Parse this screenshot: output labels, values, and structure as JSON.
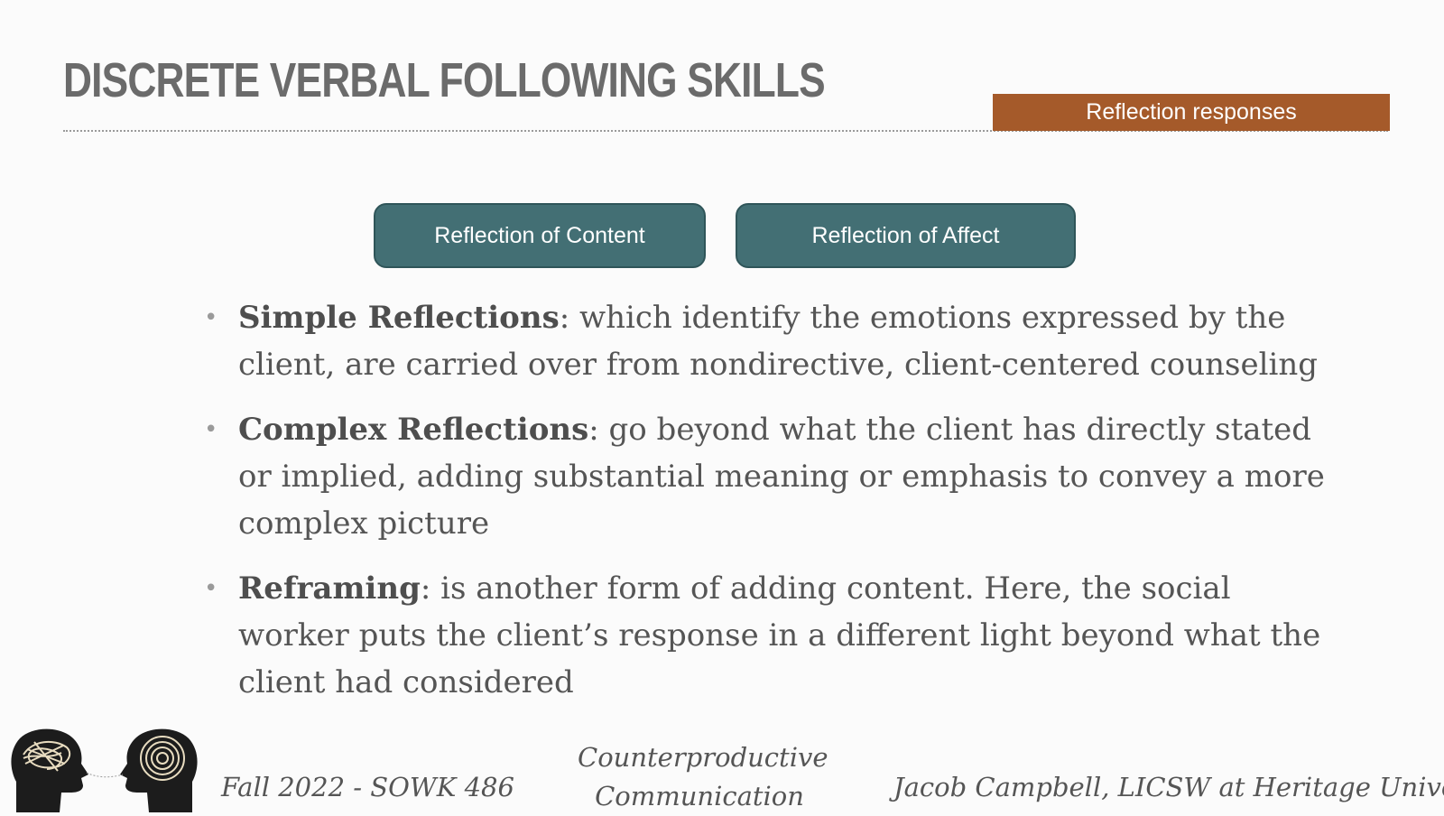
{
  "header": {
    "title": "DISCRETE VERBAL FOLLOWING SKILLS",
    "section_tag": "Reflection responses"
  },
  "categories": [
    {
      "label": "Reflection of Content"
    },
    {
      "label": "Reflection of Affect"
    }
  ],
  "bullets": [
    {
      "term": "Simple Reflections",
      "text": ": which identify the emotions expressed by the client, are carried over from nondirective, client-centered counseling"
    },
    {
      "term": "Complex Reflections",
      "text": ": go beyond what the client has directly stated or implied, adding substantial meaning or emphasis to convey a more complex picture"
    },
    {
      "term": "Reframing",
      "text": ": is another form of adding content. Here, the social worker puts the client’s response in a different light beyond what the client had considered"
    }
  ],
  "footer": {
    "course": "Fall 2022 - SOWK 486",
    "topic_line1": "Counterproductive",
    "topic_line2": "Communication",
    "author": "Jacob Campbell, LICSW at Heritage University"
  },
  "colors": {
    "tag_bg": "#a55a2a",
    "pill_bg": "#436f74",
    "title": "#6b6b6b"
  }
}
